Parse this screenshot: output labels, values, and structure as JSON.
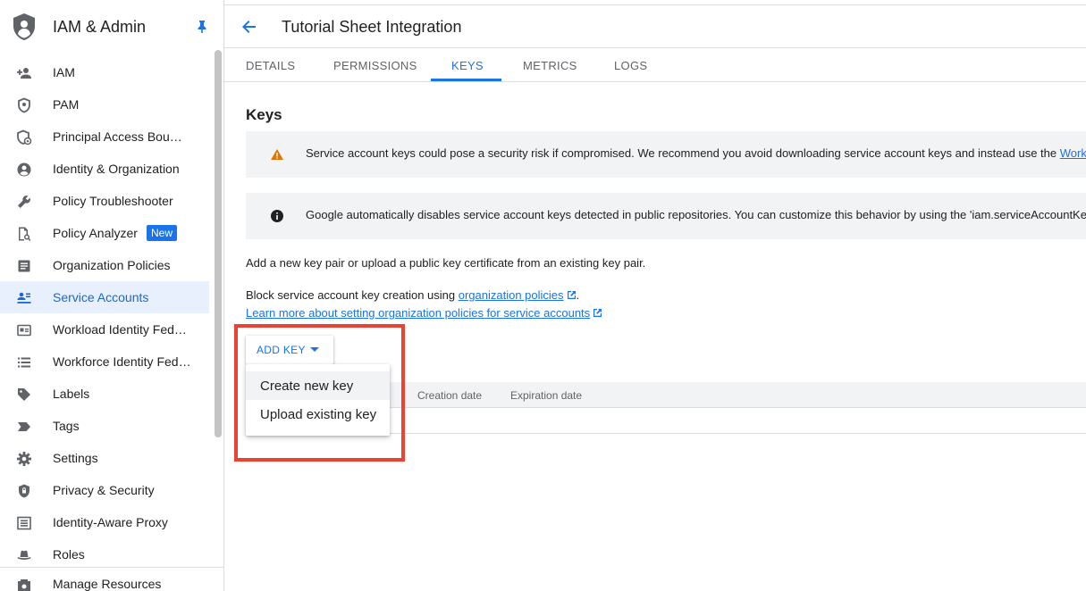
{
  "sidebar": {
    "title": "IAM & Admin",
    "items": [
      {
        "label": "IAM",
        "icon": "person-add-icon"
      },
      {
        "label": "PAM",
        "icon": "shield-icon"
      },
      {
        "label": "Principal Access Boundary Policies",
        "icon": "security-boundary-icon"
      },
      {
        "label": "Identity & Organization",
        "icon": "account-circle-icon"
      },
      {
        "label": "Policy Troubleshooter",
        "icon": "wrench-icon"
      },
      {
        "label": "Policy Analyzer",
        "icon": "document-search-icon",
        "badge": "New"
      },
      {
        "label": "Organization Policies",
        "icon": "list-document-icon"
      },
      {
        "label": "Service Accounts",
        "icon": "service-account-icon",
        "active": true
      },
      {
        "label": "Workload Identity Federation",
        "icon": "id-card-icon"
      },
      {
        "label": "Workforce Identity Federation",
        "icon": "list-icon"
      },
      {
        "label": "Labels",
        "icon": "label-icon"
      },
      {
        "label": "Tags",
        "icon": "tag-icon"
      },
      {
        "label": "Settings",
        "icon": "gear-icon"
      },
      {
        "label": "Privacy & Security",
        "icon": "shield-lock-icon"
      },
      {
        "label": "Identity-Aware Proxy",
        "icon": "proxy-icon"
      },
      {
        "label": "Roles",
        "icon": "hat-icon"
      }
    ],
    "footer": {
      "label": "Manage Resources",
      "icon": "resources-icon"
    }
  },
  "header": {
    "title": "Tutorial Sheet Integration"
  },
  "tabs": [
    {
      "label": "DETAILS"
    },
    {
      "label": "PERMISSIONS"
    },
    {
      "label": "KEYS",
      "active": true
    },
    {
      "label": "METRICS"
    },
    {
      "label": "LOGS"
    }
  ],
  "main": {
    "section_title": "Keys",
    "warning_text": "Service account keys could pose a security risk if compromised. We recommend you avoid downloading service account keys and instead use the ",
    "warning_link": "Workl",
    "info_text": "Google automatically disables service account keys detected in public repositories. You can customize this behavior by using the 'iam.serviceAccountKe",
    "add_text": "Add a new key pair or upload a public key certificate from an existing key pair.",
    "block_text": "Block service account key creation using ",
    "block_link": "organization policies",
    "block_end": ".",
    "learn_link": "Learn more about setting organization policies for service accounts",
    "add_key_label": "ADD KEY",
    "menu": [
      "Create new key",
      "Upload existing key"
    ],
    "table_headers": [
      "Creation date",
      "Expiration date"
    ]
  },
  "colors": {
    "accent": "#1a73e8",
    "warning": "#e37400",
    "highlight": "#ea4335"
  }
}
